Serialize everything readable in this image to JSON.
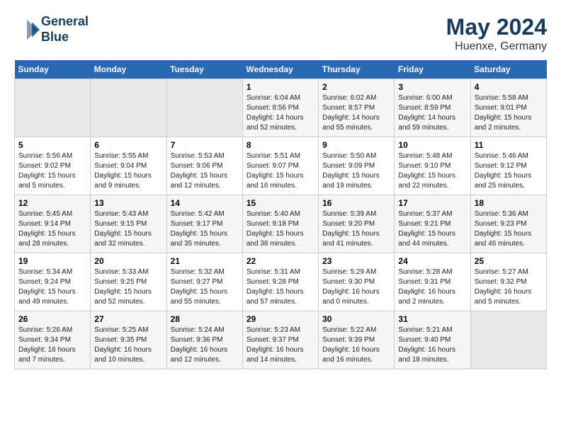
{
  "header": {
    "logo_line1": "General",
    "logo_line2": "Blue",
    "month_year": "May 2024",
    "location": "Huenxe, Germany"
  },
  "weekdays": [
    "Sunday",
    "Monday",
    "Tuesday",
    "Wednesday",
    "Thursday",
    "Friday",
    "Saturday"
  ],
  "weeks": [
    [
      {
        "day": "",
        "empty": true
      },
      {
        "day": "",
        "empty": true
      },
      {
        "day": "",
        "empty": true
      },
      {
        "day": "1",
        "sunrise": "6:04 AM",
        "sunset": "8:56 PM",
        "daylight": "14 hours and 52 minutes."
      },
      {
        "day": "2",
        "sunrise": "6:02 AM",
        "sunset": "8:57 PM",
        "daylight": "14 hours and 55 minutes."
      },
      {
        "day": "3",
        "sunrise": "6:00 AM",
        "sunset": "8:59 PM",
        "daylight": "14 hours and 59 minutes."
      },
      {
        "day": "4",
        "sunrise": "5:58 AM",
        "sunset": "9:01 PM",
        "daylight": "15 hours and 2 minutes."
      }
    ],
    [
      {
        "day": "5",
        "sunrise": "5:56 AM",
        "sunset": "9:02 PM",
        "daylight": "15 hours and 5 minutes."
      },
      {
        "day": "6",
        "sunrise": "5:55 AM",
        "sunset": "9:04 PM",
        "daylight": "15 hours and 9 minutes."
      },
      {
        "day": "7",
        "sunrise": "5:53 AM",
        "sunset": "9:06 PM",
        "daylight": "15 hours and 12 minutes."
      },
      {
        "day": "8",
        "sunrise": "5:51 AM",
        "sunset": "9:07 PM",
        "daylight": "15 hours and 16 minutes."
      },
      {
        "day": "9",
        "sunrise": "5:50 AM",
        "sunset": "9:09 PM",
        "daylight": "15 hours and 19 minutes."
      },
      {
        "day": "10",
        "sunrise": "5:48 AM",
        "sunset": "9:10 PM",
        "daylight": "15 hours and 22 minutes."
      },
      {
        "day": "11",
        "sunrise": "5:46 AM",
        "sunset": "9:12 PM",
        "daylight": "15 hours and 25 minutes."
      }
    ],
    [
      {
        "day": "12",
        "sunrise": "5:45 AM",
        "sunset": "9:14 PM",
        "daylight": "15 hours and 28 minutes."
      },
      {
        "day": "13",
        "sunrise": "5:43 AM",
        "sunset": "9:15 PM",
        "daylight": "15 hours and 32 minutes."
      },
      {
        "day": "14",
        "sunrise": "5:42 AM",
        "sunset": "9:17 PM",
        "daylight": "15 hours and 35 minutes."
      },
      {
        "day": "15",
        "sunrise": "5:40 AM",
        "sunset": "9:18 PM",
        "daylight": "15 hours and 38 minutes."
      },
      {
        "day": "16",
        "sunrise": "5:39 AM",
        "sunset": "9:20 PM",
        "daylight": "15 hours and 41 minutes."
      },
      {
        "day": "17",
        "sunrise": "5:37 AM",
        "sunset": "9:21 PM",
        "daylight": "15 hours and 44 minutes."
      },
      {
        "day": "18",
        "sunrise": "5:36 AM",
        "sunset": "9:23 PM",
        "daylight": "15 hours and 46 minutes."
      }
    ],
    [
      {
        "day": "19",
        "sunrise": "5:34 AM",
        "sunset": "9:24 PM",
        "daylight": "15 hours and 49 minutes."
      },
      {
        "day": "20",
        "sunrise": "5:33 AM",
        "sunset": "9:25 PM",
        "daylight": "15 hours and 52 minutes."
      },
      {
        "day": "21",
        "sunrise": "5:32 AM",
        "sunset": "9:27 PM",
        "daylight": "15 hours and 55 minutes."
      },
      {
        "day": "22",
        "sunrise": "5:31 AM",
        "sunset": "9:28 PM",
        "daylight": "15 hours and 57 minutes."
      },
      {
        "day": "23",
        "sunrise": "5:29 AM",
        "sunset": "9:30 PM",
        "daylight": "16 hours and 0 minutes."
      },
      {
        "day": "24",
        "sunrise": "5:28 AM",
        "sunset": "9:31 PM",
        "daylight": "16 hours and 2 minutes."
      },
      {
        "day": "25",
        "sunrise": "5:27 AM",
        "sunset": "9:32 PM",
        "daylight": "16 hours and 5 minutes."
      }
    ],
    [
      {
        "day": "26",
        "sunrise": "5:26 AM",
        "sunset": "9:34 PM",
        "daylight": "16 hours and 7 minutes."
      },
      {
        "day": "27",
        "sunrise": "5:25 AM",
        "sunset": "9:35 PM",
        "daylight": "16 hours and 10 minutes."
      },
      {
        "day": "28",
        "sunrise": "5:24 AM",
        "sunset": "9:36 PM",
        "daylight": "16 hours and 12 minutes."
      },
      {
        "day": "29",
        "sunrise": "5:23 AM",
        "sunset": "9:37 PM",
        "daylight": "16 hours and 14 minutes."
      },
      {
        "day": "30",
        "sunrise": "5:22 AM",
        "sunset": "9:39 PM",
        "daylight": "16 hours and 16 minutes."
      },
      {
        "day": "31",
        "sunrise": "5:21 AM",
        "sunset": "9:40 PM",
        "daylight": "16 hours and 18 minutes."
      },
      {
        "day": "",
        "empty": true
      }
    ]
  ]
}
